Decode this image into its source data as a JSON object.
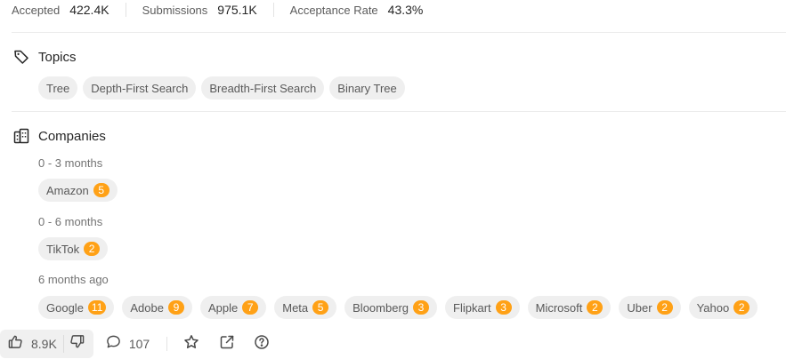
{
  "stats": [
    {
      "label": "Accepted",
      "value": "422.4K"
    },
    {
      "label": "Submissions",
      "value": "975.1K"
    },
    {
      "label": "Acceptance Rate",
      "value": "43.3%"
    }
  ],
  "topics": {
    "title": "Topics",
    "icon": "tag-icon",
    "tags": [
      "Tree",
      "Depth-First Search",
      "Breadth-First Search",
      "Binary Tree"
    ]
  },
  "companies": {
    "title": "Companies",
    "icon": "building-icon",
    "badge_color": "#ffa116",
    "groups": [
      {
        "period": "0 - 3 months",
        "items": [
          {
            "name": "Amazon",
            "count": "5"
          }
        ]
      },
      {
        "period": "0 - 6 months",
        "items": [
          {
            "name": "TikTok",
            "count": "2"
          }
        ]
      },
      {
        "period": "6 months ago",
        "items": [
          {
            "name": "Google",
            "count": "11"
          },
          {
            "name": "Adobe",
            "count": "9"
          },
          {
            "name": "Apple",
            "count": "7"
          },
          {
            "name": "Meta",
            "count": "5"
          },
          {
            "name": "Bloomberg",
            "count": "3"
          },
          {
            "name": "Flipkart",
            "count": "3"
          },
          {
            "name": "Microsoft",
            "count": "2"
          },
          {
            "name": "Uber",
            "count": "2"
          },
          {
            "name": "Yahoo",
            "count": "2"
          }
        ]
      }
    ]
  },
  "footer": {
    "likes": "8.9K",
    "comments": "107",
    "icons": [
      "thumbs-up-icon",
      "thumbs-down-icon",
      "comment-icon",
      "star-icon",
      "share-icon",
      "help-icon"
    ]
  }
}
